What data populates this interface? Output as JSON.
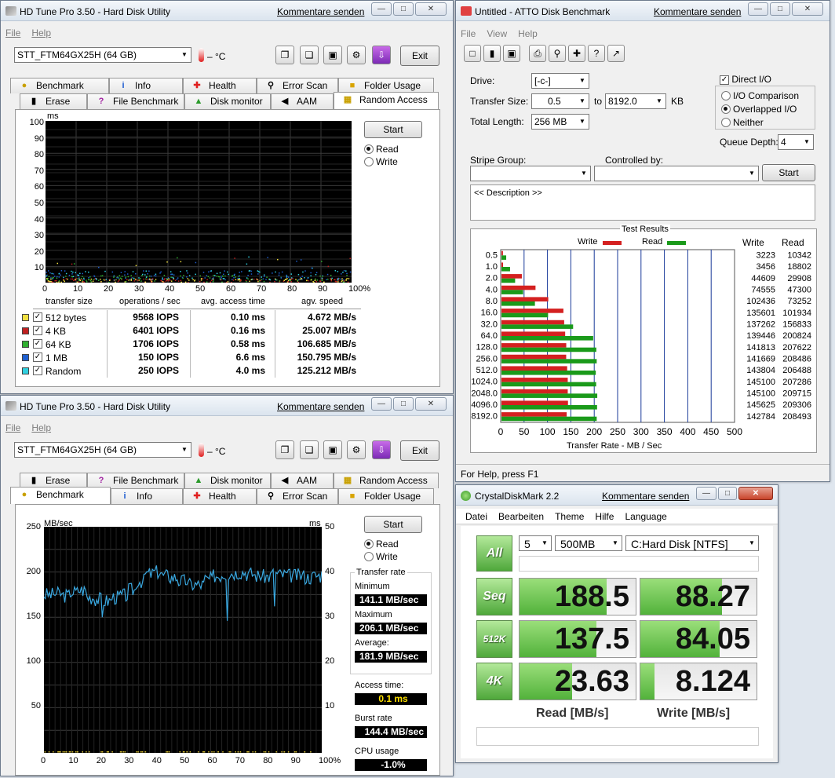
{
  "hdtune_top": {
    "title": "HD Tune Pro 3.50 - Hard Disk Utility",
    "feedback": "Kommentare senden",
    "menu": [
      "File",
      "Help"
    ],
    "drive": "STT_FTM64GX25H (64 GB)",
    "temp": "– °C",
    "exit": "Exit",
    "tabs_back": [
      "Benchmark",
      "Info",
      "Health",
      "Error Scan",
      "Folder Usage"
    ],
    "tabs_front": [
      "Erase",
      "File Benchmark",
      "Disk monitor",
      "AAM",
      "Random Access"
    ],
    "start": "Start",
    "read": "Read",
    "write": "Write",
    "y_unit": "ms",
    "y_ticks": [
      "100",
      "90",
      "80",
      "70",
      "60",
      "50",
      "40",
      "30",
      "20",
      "10"
    ],
    "x_ticks": [
      "0",
      "10",
      "20",
      "30",
      "40",
      "50",
      "60",
      "70",
      "80",
      "90",
      "100%"
    ],
    "table_headers": [
      "transfer size",
      "operations / sec",
      "avg. access time",
      "agv. speed"
    ],
    "rows": [
      {
        "size": "512 bytes",
        "ops": "9568 IOPS",
        "time": "0.10 ms",
        "speed": "4.672 MB/s",
        "color": "#f0e040"
      },
      {
        "size": "4 KB",
        "ops": "6401 IOPS",
        "time": "0.16 ms",
        "speed": "25.007 MB/s",
        "color": "#c02020"
      },
      {
        "size": "64 KB",
        "ops": "1706 IOPS",
        "time": "0.58 ms",
        "speed": "106.685 MB/s",
        "color": "#30b030"
      },
      {
        "size": "1 MB",
        "ops": "150 IOPS",
        "time": "6.6 ms",
        "speed": "150.795 MB/s",
        "color": "#2060d0"
      },
      {
        "size": "Random",
        "ops": "250 IOPS",
        "time": "4.0 ms",
        "speed": "125.212 MB/s",
        "color": "#30d0e0"
      }
    ]
  },
  "hdtune_bottom": {
    "title": "HD Tune Pro 3.50 - Hard Disk Utility",
    "feedback": "Kommentare senden",
    "menu": [
      "File",
      "Help"
    ],
    "drive": "STT_FTM64GX25H (64 GB)",
    "temp": "– °C",
    "exit": "Exit",
    "tabs_back": [
      "Erase",
      "File Benchmark",
      "Disk monitor",
      "AAM",
      "Random Access"
    ],
    "tabs_front": [
      "Benchmark",
      "Info",
      "Health",
      "Error Scan",
      "Folder Usage"
    ],
    "start": "Start",
    "read": "Read",
    "write": "Write",
    "y_unit": "MB/sec",
    "y2_unit": "ms",
    "y_ticks": [
      "250",
      "200",
      "150",
      "100",
      "50"
    ],
    "y2_ticks": [
      "50",
      "40",
      "30",
      "20",
      "10"
    ],
    "x_ticks": [
      "0",
      "10",
      "20",
      "30",
      "40",
      "50",
      "60",
      "70",
      "80",
      "90",
      "100%"
    ],
    "transfer_rate": "Transfer rate",
    "minimum_label": "Minimum",
    "minimum": "141.1 MB/sec",
    "maximum_label": "Maximum",
    "maximum": "206.1 MB/sec",
    "average_label": "Average:",
    "average": "181.9 MB/sec",
    "access_label": "Access time:",
    "access": "0.1 ms",
    "burst_label": "Burst rate",
    "burst": "144.4 MB/sec",
    "cpu_label": "CPU usage",
    "cpu": "-1.0%"
  },
  "atto": {
    "title": "Untitled - ATTO Disk Benchmark",
    "feedback": "Kommentare senden",
    "menu": [
      "File",
      "View",
      "Help"
    ],
    "drive_label": "Drive:",
    "drive": "[-c-]",
    "transfer_label": "Transfer Size:",
    "transfer_from": "0.5",
    "to": "to",
    "transfer_to": "8192.0",
    "kb": "KB",
    "total_label": "Total Length:",
    "total": "256 MB",
    "direct_io": "Direct I/O",
    "io_comparison": "I/O Comparison",
    "overlapped": "Overlapped I/O",
    "neither": "Neither",
    "queue_label": "Queue Depth:",
    "queue": "4",
    "stripe_label": "Stripe Group:",
    "controlled_label": "Controlled by:",
    "start": "Start",
    "description": "<< Description >>",
    "results_title": "Test Results",
    "write_legend": "Write",
    "read_legend": "Read",
    "col_write": "Write",
    "col_read": "Read",
    "xlabel": "Transfer Rate - MB / Sec",
    "status": "For Help, press F1"
  },
  "atto_chart": {
    "type": "bar",
    "categories": [
      "0.5",
      "1.0",
      "2.0",
      "4.0",
      "8.0",
      "16.0",
      "32.0",
      "64.0",
      "128.0",
      "256.0",
      "512.0",
      "1024.0",
      "2048.0",
      "4096.0",
      "8192.0"
    ],
    "series": [
      {
        "name": "Write",
        "values": [
          3223,
          3456,
          44609,
          74555,
          102436,
          135601,
          137262,
          139446,
          141813,
          141669,
          143804,
          145100,
          145100,
          145625,
          142784
        ],
        "color": "#d42020"
      },
      {
        "name": "Read",
        "values": [
          10342,
          18802,
          29908,
          47300,
          73252,
          101934,
          156833,
          200824,
          207622,
          208486,
          206488,
          207286,
          209715,
          209306,
          208493
        ],
        "color": "#1a9a1a"
      }
    ],
    "write_text": [
      "3223",
      "3456",
      "44609",
      "74555",
      "102436",
      "135601",
      "137262",
      "139446",
      "141813",
      "141669",
      "143804",
      "145100",
      "145100",
      "145625",
      "142784"
    ],
    "read_text": [
      "10342",
      "18802",
      "29908",
      "47300",
      "73252",
      "101934",
      "156833",
      "200824",
      "207622",
      "208486",
      "206488",
      "207286",
      "209715",
      "209306",
      "208493"
    ],
    "x_ticks": [
      "0",
      "50",
      "100",
      "150",
      "200",
      "250",
      "300",
      "350",
      "400",
      "450",
      "500"
    ],
    "xlim": [
      0,
      500
    ]
  },
  "cdm": {
    "title": "CrystalDiskMark 2.2",
    "feedback": "Kommentare senden",
    "menu": [
      "Datei",
      "Bearbeiten",
      "Theme",
      "Hilfe",
      "Language"
    ],
    "all": "All",
    "count": "5",
    "size": "500MB",
    "drive": "C:Hard Disk [NTFS]",
    "rows": [
      {
        "label": "Seq",
        "read": "188.5",
        "write": "88.27",
        "read_frac": 0.75,
        "write_frac": 0.7
      },
      {
        "label": "512K",
        "read": "137.5",
        "write": "84.05",
        "read_frac": 0.66,
        "write_frac": 0.68
      },
      {
        "label": "4K",
        "read": "23.63",
        "write": "8.124",
        "read_frac": 0.45,
        "write_frac": 0.12
      }
    ],
    "read_label": "Read [MB/s]",
    "write_label": "Write [MB/s]"
  }
}
